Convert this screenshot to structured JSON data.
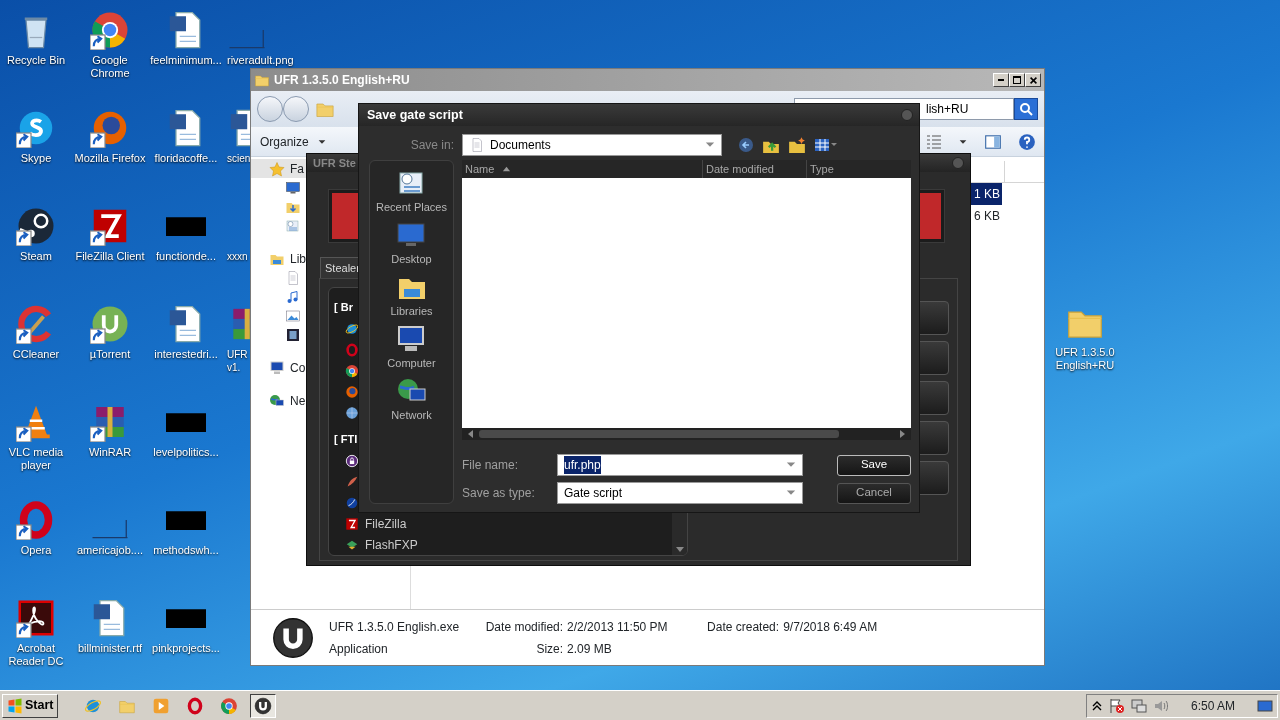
{
  "desktop_columns": [
    [
      {
        "label": "Recycle Bin",
        "kind": "recycle",
        "shortcut": false
      },
      {
        "label": "Skype",
        "kind": "skype",
        "shortcut": true
      },
      {
        "label": "Steam",
        "kind": "steam",
        "shortcut": true
      },
      {
        "label": "CCleaner",
        "kind": "ccleaner",
        "shortcut": true
      },
      {
        "label": "VLC media player",
        "kind": "vlc",
        "shortcut": true
      },
      {
        "label": "Opera",
        "kind": "opera",
        "shortcut": true
      },
      {
        "label": "Acrobat Reader DC",
        "kind": "acrobat",
        "shortcut": true
      }
    ],
    [
      {
        "label": "Google Chrome",
        "kind": "chrome",
        "shortcut": true
      },
      {
        "label": "Mozilla Firefox",
        "kind": "firefox",
        "shortcut": true
      },
      {
        "label": "FileZilla Client",
        "kind": "filezilla",
        "shortcut": true
      },
      {
        "label": "µTorrent",
        "kind": "utorrent",
        "shortcut": true
      },
      {
        "label": "WinRAR",
        "kind": "winrar",
        "shortcut": true
      },
      {
        "label": "americajob....",
        "kind": "line",
        "shortcut": false
      },
      {
        "label": "billminister.rtf",
        "kind": "word",
        "shortcut": false
      }
    ],
    [
      {
        "label": "feelminimum...",
        "kind": "word",
        "shortcut": false
      },
      {
        "label": "floridacoffe...",
        "kind": "word",
        "shortcut": false
      },
      {
        "label": "functionde...",
        "kind": "black",
        "shortcut": false
      },
      {
        "label": "interestedri...",
        "kind": "word",
        "shortcut": false
      },
      {
        "label": "levelpolitics...",
        "kind": "black",
        "shortcut": false
      },
      {
        "label": "methodswh...",
        "kind": "black",
        "shortcut": false
      },
      {
        "label": "pinkprojects...",
        "kind": "black",
        "shortcut": false
      }
    ],
    [
      {
        "label": "riveradult.png",
        "kind": "line",
        "shortcut": false
      },
      {
        "label": "scien",
        "kind": "word"
      },
      {
        "label": "xxxn",
        "kind": "none"
      },
      {
        "label": "UFR v1.",
        "kind": "winrar"
      }
    ]
  ],
  "desktop_right": [
    {
      "label": "UFR 1.3.5.0 English+RU",
      "kind": "folder",
      "shortcut": false
    }
  ],
  "explorer": {
    "title": "UFR 1.3.5.0 English+RU",
    "search_value": "lish+RU",
    "organize": "Organize",
    "nav_items": [
      {
        "label": "Fa",
        "kind": "star",
        "selected": true
      },
      {
        "kind": "desktop",
        "selected": false
      },
      {
        "kind": "downloads",
        "selected": false
      },
      {
        "kind": "recent",
        "selected": false
      },
      {
        "label": "Lib",
        "kind": "library",
        "selected": false
      },
      {
        "kind": "doc",
        "selected": false
      },
      {
        "kind": "music",
        "selected": false
      },
      {
        "kind": "pictures",
        "selected": false
      },
      {
        "kind": "video",
        "selected": false
      },
      {
        "label": "Co",
        "kind": "computer",
        "selected": false
      },
      {
        "label": "Ne",
        "kind": "network",
        "selected": false
      }
    ],
    "file_sizes": [
      {
        "text": "1 KB",
        "selected": true
      },
      {
        "text": "6 KB",
        "selected": false
      }
    ],
    "details": {
      "name": "UFR 1.3.5.0 English.exe",
      "type": "Application",
      "fields": [
        {
          "label": "Date modified:",
          "value": "2/2/2013 11:50 PM"
        },
        {
          "label": "Date created:",
          "value": "9/7/2018 6:49 AM"
        },
        {
          "label": "Size:",
          "value": "2.09 MB"
        }
      ]
    }
  },
  "stealer": {
    "title": "UFR Ste",
    "tab": "Stealer",
    "groups": [
      {
        "header": "[ Br",
        "items": [
          {
            "kind": "ie"
          },
          {
            "kind": "opera"
          },
          {
            "kind": "chrome"
          },
          {
            "kind": "firefox"
          },
          {
            "kind": "globe"
          }
        ]
      },
      {
        "header": "[ FTI",
        "items": [
          {
            "kind": "lock"
          },
          {
            "kind": "feather"
          },
          {
            "kind": "sphere"
          },
          {
            "kind": "filezilla",
            "label": "FileZilla"
          },
          {
            "kind": "flashfxp",
            "label": "FlashFXP"
          }
        ]
      }
    ]
  },
  "save_dialog": {
    "title": "Save gate script",
    "save_in_label": "Save in:",
    "save_in_value": "Documents",
    "places": [
      {
        "label": "Recent Places",
        "kind": "recent"
      },
      {
        "label": "Desktop",
        "kind": "desktop"
      },
      {
        "label": "Libraries",
        "kind": "library"
      },
      {
        "label": "Computer",
        "kind": "computer"
      },
      {
        "label": "Network",
        "kind": "network"
      }
    ],
    "columns": [
      "Name",
      "Date modified",
      "Type"
    ],
    "file_name": {
      "label": "File name:",
      "value": "ufr.php",
      "selected": true
    },
    "save_as_type": {
      "label": "Save as type:",
      "value": "Gate script"
    },
    "buttons": [
      {
        "label": "Save",
        "default": true
      },
      {
        "label": "Cancel",
        "default": false
      }
    ]
  },
  "taskbar": {
    "start": "Start",
    "apps": [
      {
        "kind": "ie",
        "active": false
      },
      {
        "kind": "folder",
        "active": false
      },
      {
        "kind": "media",
        "active": false
      },
      {
        "kind": "opera",
        "active": false
      },
      {
        "kind": "chrome",
        "active": false
      },
      {
        "kind": "ufr",
        "active": true
      }
    ],
    "clock": "6:50 AM"
  }
}
